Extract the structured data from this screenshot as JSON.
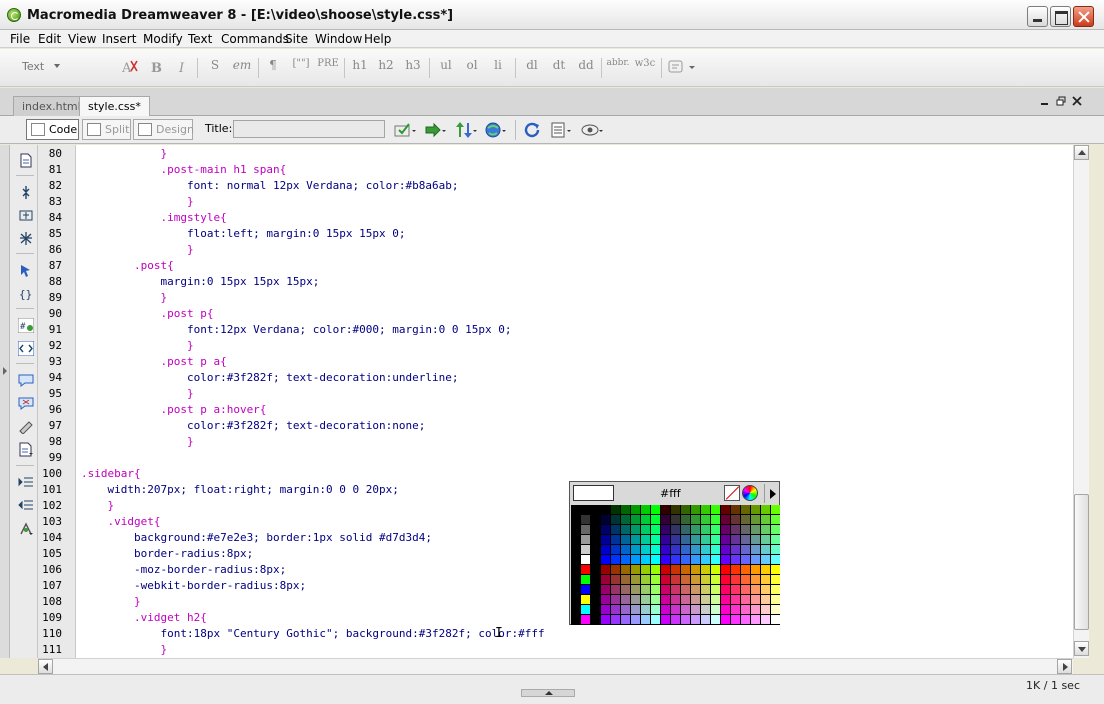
{
  "window": {
    "title": "Macromedia Dreamweaver 8 - [E:\\video\\shoose\\style.css*]"
  },
  "menu": [
    "File",
    "Edit",
    "View",
    "Insert",
    "Modify",
    "Text",
    "Commands",
    "Site",
    "Window",
    "Help"
  ],
  "insert_bar": {
    "category": "Text",
    "buttons": [
      "S",
      "em",
      "¶",
      "[\"\"]",
      "PRE",
      "h1",
      "h2",
      "h3",
      "ul",
      "ol",
      "li",
      "dl",
      "dt",
      "dd",
      "abbr.",
      "w3c"
    ]
  },
  "tabs": [
    {
      "label": "index.html",
      "active": false
    },
    {
      "label": "style.css*",
      "active": true
    }
  ],
  "doc_toolbar": {
    "code_label": "Code",
    "split_label": "Split",
    "design_label": "Design",
    "title_label": "Title:",
    "title_value": ""
  },
  "code": {
    "lines": [
      {
        "n": "80",
        "text": "            }"
      },
      {
        "n": "81",
        "text": "            .post-main h1 span{"
      },
      {
        "n": "82",
        "text": "                font: normal 12px Verdana; color:#b8a6ab;"
      },
      {
        "n": "83",
        "text": "                }"
      },
      {
        "n": "84",
        "text": "            .imgstyle{"
      },
      {
        "n": "85",
        "text": "                float:left; margin:0 15px 15px 0;"
      },
      {
        "n": "86",
        "text": "                }"
      },
      {
        "n": "87",
        "text": "        .post{"
      },
      {
        "n": "88",
        "text": "            margin:0 15px 15px 15px;"
      },
      {
        "n": "89",
        "text": "            }"
      },
      {
        "n": "90",
        "text": "            .post p{"
      },
      {
        "n": "91",
        "text": "                font:12px Verdana; color:#000; margin:0 0 15px 0;"
      },
      {
        "n": "92",
        "text": "                }"
      },
      {
        "n": "93",
        "text": "            .post p a{"
      },
      {
        "n": "94",
        "text": "                color:#3f282f; text-decoration:underline;"
      },
      {
        "n": "95",
        "text": "                }"
      },
      {
        "n": "96",
        "text": "            .post p a:hover{"
      },
      {
        "n": "97",
        "text": "                color:#3f282f; text-decoration:none;"
      },
      {
        "n": "98",
        "text": "                }"
      },
      {
        "n": "99",
        "text": ""
      },
      {
        "n": "100",
        "text": ".sidebar{"
      },
      {
        "n": "101",
        "text": "    width:207px; float:right; margin:0 0 0 20px;"
      },
      {
        "n": "102",
        "text": "    }"
      },
      {
        "n": "103",
        "text": "    .vidget{"
      },
      {
        "n": "104",
        "text": "        background:#e7e2e3; border:1px solid #d7d3d4;"
      },
      {
        "n": "105",
        "text": "        border-radius:8px;"
      },
      {
        "n": "106",
        "text": "        -moz-border-radius:8px;"
      },
      {
        "n": "107",
        "text": "        -webkit-border-radius:8px;"
      },
      {
        "n": "108",
        "text": "        }"
      },
      {
        "n": "109",
        "text": "        .vidget h2{"
      },
      {
        "n": "110",
        "text": "            font:18px \"Century Gothic\"; background:#3f282f; color:#fff"
      },
      {
        "n": "111",
        "text": "            }"
      }
    ]
  },
  "color_picker": {
    "hex": "#fff",
    "current_color": "#ffffff"
  },
  "status": {
    "size_time": "1K / 1 sec"
  },
  "colors": {
    "code_text": "#000080",
    "selector_text": "#c000c0"
  }
}
